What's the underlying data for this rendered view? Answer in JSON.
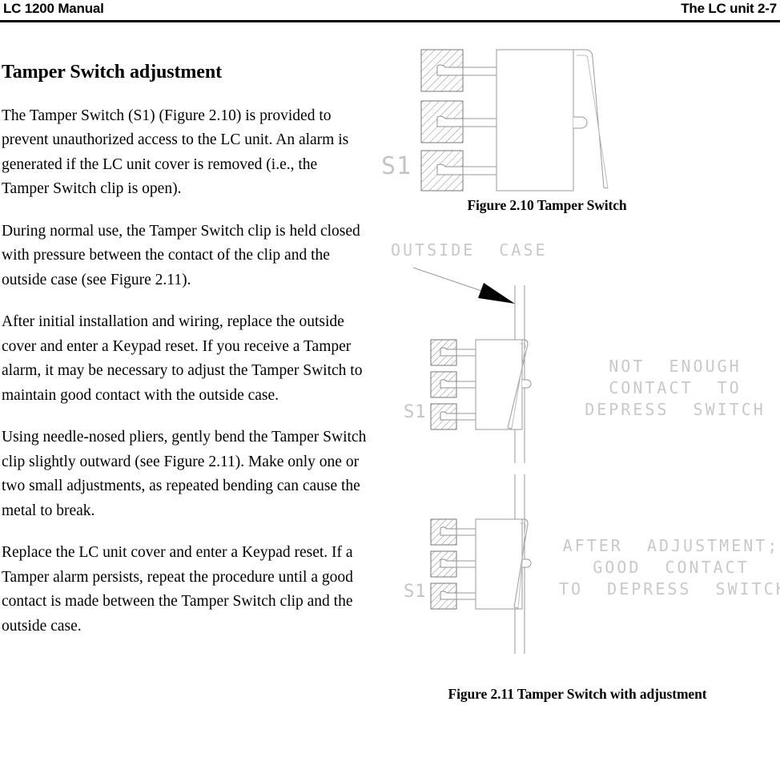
{
  "header": {
    "left": "LC 1200 Manual",
    "right": "The LC unit 2-7"
  },
  "body": {
    "section_title": "Tamper Switch adjustment",
    "paragraphs": [
      "The Tamper Switch (S1) (Figure 2.10) is provided to prevent unauthorized access to the LC unit. An alarm is generated if the LC unit cover is removed (i.e., the Tamper Switch clip is open).",
      "During normal use, the Tamper Switch clip is held closed with pressure between the contact of the clip and the outside case (see Figure 2.11).",
      "After initial installation and wiring, replace the outside cover and enter a Keypad reset. If you receive a Tamper alarm, it may be necessary to adjust the Tamper Switch to maintain good contact with the outside case.",
      "Using needle-nosed pliers, gently bend the Tamper Switch clip slightly outward (see Figure 2.11). Make only one or two small adjustments, as repeated bending can cause the metal to break.",
      "Replace the LC unit cover and enter a Keypad reset. If a Tamper alarm persists, repeat the procedure until a good contact is made between the Tamper Switch clip and the outside case."
    ]
  },
  "figures": {
    "fig210": {
      "caption": "Figure 2.10 Tamper Switch",
      "switch_label": "S1"
    },
    "fig211": {
      "caption": "Figure 2.11 Tamper Switch with adjustment",
      "case_label": "OUTSIDE  CASE",
      "switch_label_top": "S1",
      "switch_label_bottom": "S1",
      "note_top": [
        "NOT  ENOUGH",
        "CONTACT  TO",
        "DEPRESS  SWITCH"
      ],
      "note_bottom": [
        "AFTER  ADJUSTMENT;",
        "GOOD  CONTACT",
        "TO  DEPRESS  SWITCH"
      ]
    }
  },
  "colors": {
    "ink": "#000000",
    "line": "#9a9a9a",
    "line_light": "#bdbdbd",
    "cad_text": "#c9c9c9",
    "hatch": "#8c8c8c",
    "paper": "#ffffff"
  }
}
